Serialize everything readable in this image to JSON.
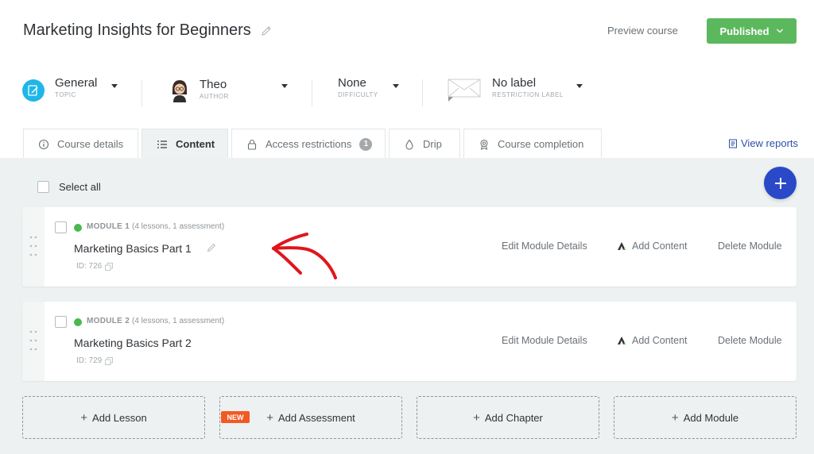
{
  "header": {
    "title": "Marketing Insights for Beginners",
    "preview_label": "Preview course",
    "status_label": "Published"
  },
  "meta": {
    "topic": {
      "value": "General",
      "label": "TOPIC"
    },
    "author": {
      "value": "Theo",
      "label": "AUTHOR"
    },
    "difficulty": {
      "value": "None",
      "label": "DIFFICULTY"
    },
    "restriction": {
      "value": "No label",
      "label": "RESTRICTION LABEL"
    }
  },
  "tabs": [
    {
      "label": "Course details",
      "icon": "info-icon"
    },
    {
      "label": "Content",
      "icon": "list-icon"
    },
    {
      "label": "Access restrictions",
      "icon": "lock-icon",
      "badge": "1"
    },
    {
      "label": "Drip",
      "icon": "drop-icon"
    },
    {
      "label": "Course completion",
      "icon": "award-icon"
    }
  ],
  "view_reports_label": "View reports",
  "content": {
    "select_all_label": "Select all",
    "modules": [
      {
        "tag": "MODULE 1",
        "count": "(4 lessons, 1 assessment)",
        "name": "Marketing Basics Part 1",
        "id": "ID: 726"
      },
      {
        "tag": "MODULE 2",
        "count": "(4 lessons, 1 assessment)",
        "name": "Marketing Basics Part 2",
        "id": "ID: 729"
      }
    ],
    "actions": {
      "edit": "Edit Module Details",
      "add": "Add Content",
      "delete": "Delete Module"
    },
    "add_buttons": {
      "lesson": "Add Lesson",
      "assessment": "Add Assessment",
      "chapter": "Add Chapter",
      "module": "Add Module",
      "new_badge": "NEW"
    }
  },
  "colors": {
    "published": "#5cb85c",
    "fab": "#2a49c9",
    "topic_icon": "#1fb6e8",
    "module_status": "#4cb84f",
    "new_badge": "#f15a22",
    "annotation_arrow": "#e0161b"
  }
}
